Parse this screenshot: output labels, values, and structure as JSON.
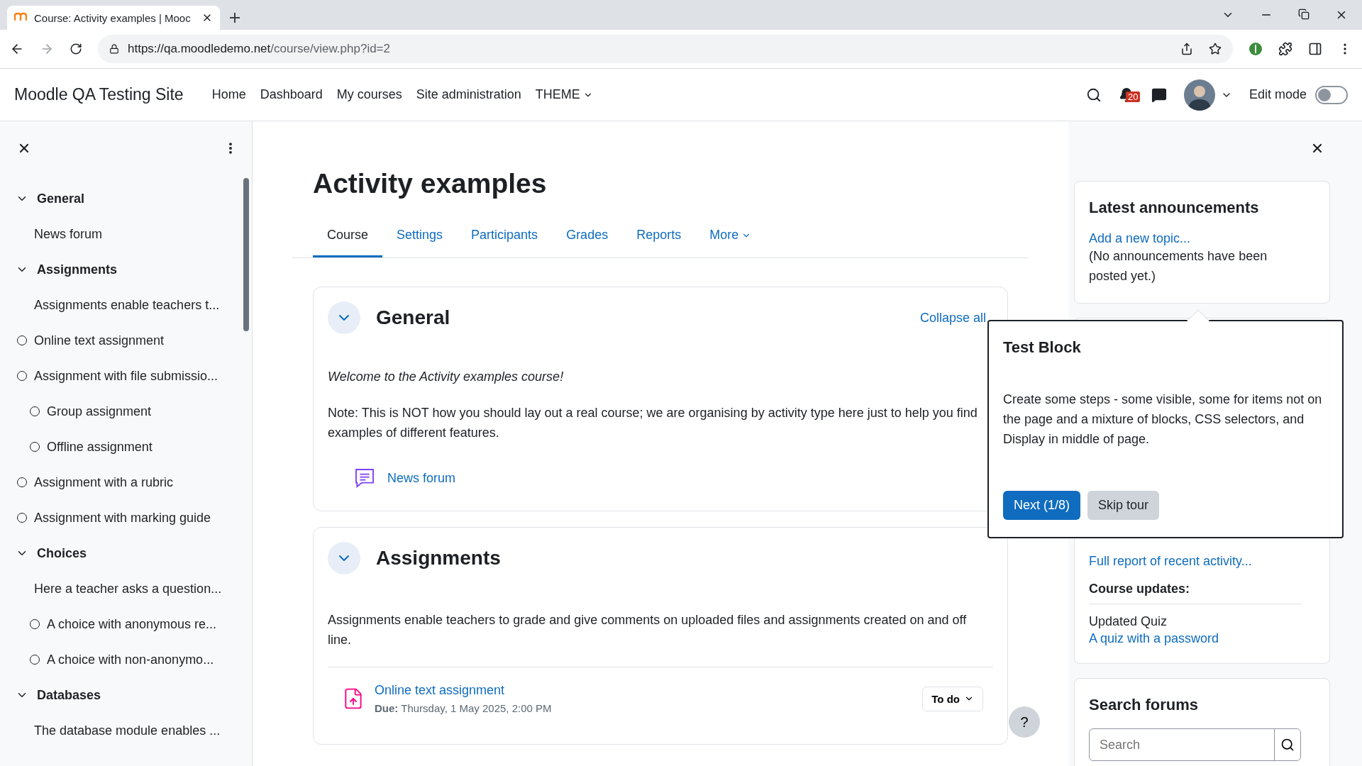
{
  "browser": {
    "tab_title": "Course: Activity examples | Mooc",
    "url_host": "https://qa.moodledemo.net",
    "url_path": "/course/view.php?id=2"
  },
  "navbar": {
    "site_name": "Moodle QA Testing Site",
    "links": [
      {
        "label": "Home",
        "kind": "link"
      },
      {
        "label": "Dashboard",
        "kind": "link"
      },
      {
        "label": "My courses",
        "kind": "link"
      },
      {
        "label": "Site administration",
        "kind": "link"
      },
      {
        "label": "THEME",
        "kind": "dropdown"
      }
    ],
    "notification_count": "20",
    "edit_mode": {
      "label": "Edit mode",
      "on": false
    }
  },
  "sidebar": {
    "sections": [
      {
        "title": "General",
        "expanded": true,
        "children": [
          {
            "label": "News forum",
            "tracked": false
          }
        ]
      },
      {
        "title": "Assignments",
        "expanded": true,
        "children": [
          {
            "label": "Assignments enable teachers t...",
            "tracked": false
          },
          {
            "label": "Online text assignment",
            "tracked": true
          },
          {
            "label": "Assignment with file submissio...",
            "tracked": true,
            "children": [
              {
                "label": "Group assignment",
                "tracked": true
              },
              {
                "label": "Offline assignment",
                "tracked": true
              }
            ]
          },
          {
            "label": "Assignment with a rubric",
            "tracked": true
          },
          {
            "label": "Assignment with marking guide",
            "tracked": true
          }
        ]
      },
      {
        "title": "Choices",
        "expanded": true,
        "children": [
          {
            "label": "Here a teacher asks a question...",
            "tracked": false,
            "children": [
              {
                "label": "A choice with anonymous re...",
                "tracked": true
              },
              {
                "label": "A choice with non-anonymo...",
                "tracked": true
              }
            ]
          }
        ]
      },
      {
        "title": "Databases",
        "expanded": true,
        "children": [
          {
            "label": "The database module enables ...",
            "tracked": false
          }
        ]
      }
    ]
  },
  "main": {
    "title": "Activity examples",
    "tabs": [
      {
        "label": "Course",
        "selected": true,
        "kind": "link"
      },
      {
        "label": "Settings",
        "selected": false,
        "kind": "link"
      },
      {
        "label": "Participants",
        "selected": false,
        "kind": "link"
      },
      {
        "label": "Grades",
        "selected": false,
        "kind": "link"
      },
      {
        "label": "Reports",
        "selected": false,
        "kind": "link"
      },
      {
        "label": "More",
        "selected": false,
        "kind": "dropdown"
      }
    ],
    "sections": [
      {
        "title": "General",
        "expanded": true,
        "action": "Collapse all",
        "welcome": "Welcome to the Activity examples course!",
        "description": "Note: This is NOT how you should lay out a real course; we are organising by activity type here just to help you find examples of different features.",
        "activities": [
          {
            "name": "News forum",
            "kind": "forum"
          }
        ]
      },
      {
        "title": "Assignments",
        "expanded": true,
        "description": "Assignments enable teachers to grade and give comments on uploaded files and assignments created on and off line.",
        "activities": [
          {
            "name": "Online text assignment",
            "kind": "assignment",
            "due_label": "Due:",
            "due": "Thursday, 1 May 2025, 2:00 PM",
            "status": "To do"
          }
        ]
      }
    ]
  },
  "blocks": {
    "announcements": {
      "title": "Latest announcements",
      "link": "Add a new topic...",
      "text": "(No announcements have been posted yet.)"
    },
    "recent": {
      "link": "Full report of recent activity...",
      "updates_title": "Course updates:",
      "update_type": "Updated Quiz",
      "update_link": "A quiz with a password"
    },
    "search": {
      "title": "Search forums",
      "placeholder": "Search"
    }
  },
  "tour": {
    "title": "Test Block",
    "text": "Create some steps - some visible, some for items not on the page and a mixture of blocks, CSS selectors, and Display in middle of page.",
    "next": "Next (1/8)",
    "skip": "Skip tour"
  },
  "help": "?"
}
